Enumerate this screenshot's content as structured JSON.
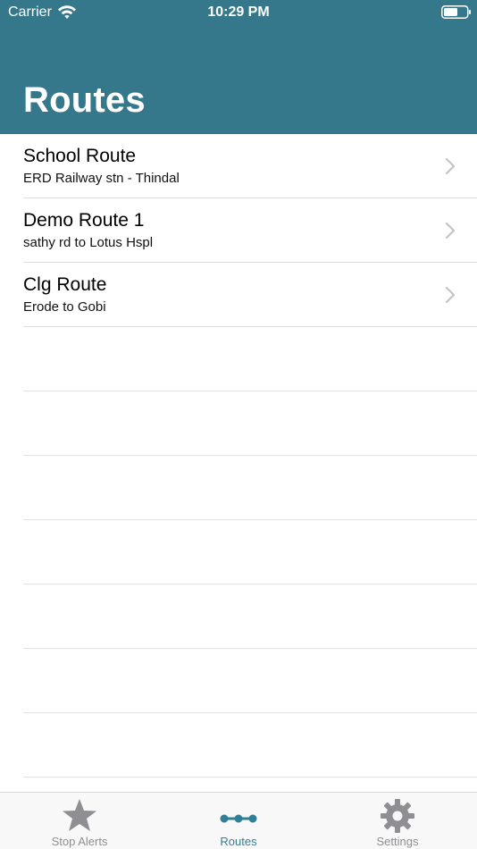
{
  "status_bar": {
    "carrier": "Carrier",
    "time": "10:29 PM"
  },
  "nav": {
    "title": "Routes",
    "background_color": "#35788b"
  },
  "routes": [
    {
      "title": "School Route",
      "subtitle": "ERD Railway stn - Thindal"
    },
    {
      "title": "Demo Route 1",
      "subtitle": "sathy rd to Lotus Hspl"
    },
    {
      "title": "Clg Route",
      "subtitle": "Erode to Gobi"
    }
  ],
  "tab_bar": {
    "tabs": [
      {
        "label": "Stop Alerts",
        "icon": "star-icon",
        "active": false
      },
      {
        "label": "Routes",
        "icon": "route-dots-icon",
        "active": true
      },
      {
        "label": "Settings",
        "icon": "gear-icon",
        "active": false
      }
    ],
    "active_color": "#2f7f96",
    "inactive_color": "#8e8e93"
  }
}
